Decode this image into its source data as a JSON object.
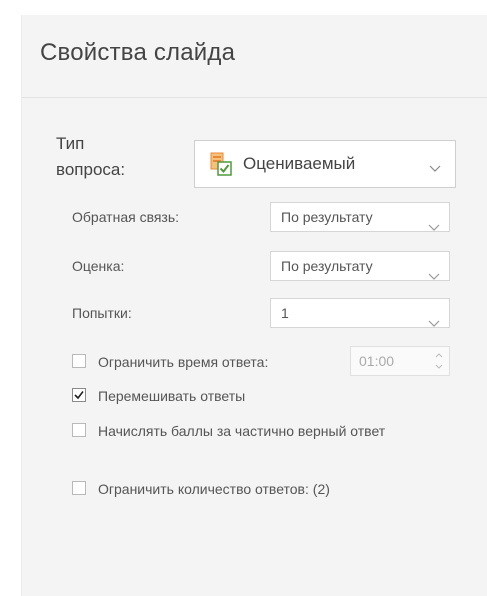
{
  "panel": {
    "title": "Свойства слайда"
  },
  "question_type": {
    "label": "Тип вопроса:",
    "value": "Оцениваемый",
    "icon": "graded-question-icon"
  },
  "properties": [
    {
      "label": "Обратная связь:",
      "value": "По результату"
    },
    {
      "label": "Оценка:",
      "value": "По результату"
    },
    {
      "label": "Попытки:",
      "value": "1"
    }
  ],
  "options": {
    "limit_time": {
      "label": "Ограничить время ответа:",
      "checked": false,
      "time_value": "01:00"
    },
    "shuffle": {
      "label": "Перемешивать ответы",
      "checked": true
    },
    "partial": {
      "label": "Начислять баллы за частично верный ответ",
      "checked": false
    },
    "limit_answers": {
      "label": "Ограничить количество ответов: (2)",
      "checked": false
    }
  },
  "colors": {
    "panel_background": "#f4f4f4",
    "icon_orange": "#e8883a",
    "icon_green": "#4f9a3f"
  }
}
